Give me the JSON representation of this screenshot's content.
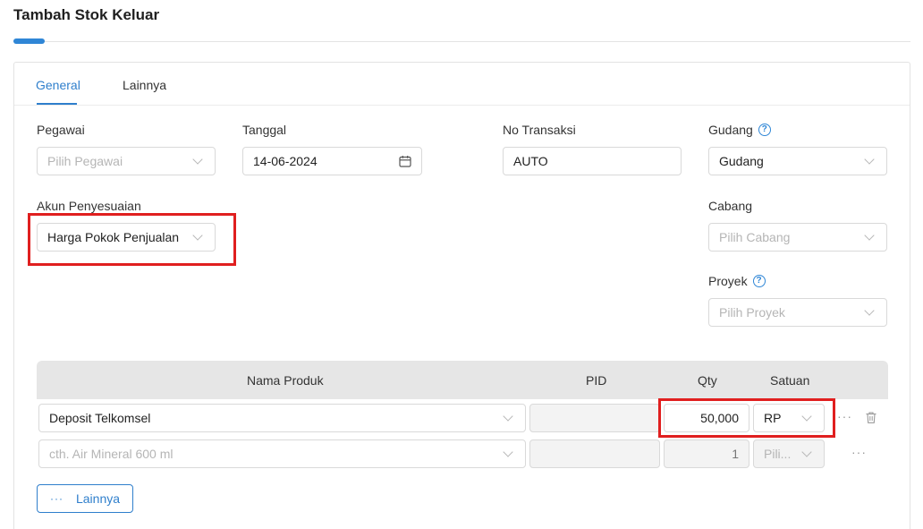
{
  "page": {
    "title": "Tambah Stok Keluar"
  },
  "tabs": [
    {
      "label": "General",
      "active": true
    },
    {
      "label": "Lainnya",
      "active": false
    }
  ],
  "form": {
    "pegawai": {
      "label": "Pegawai",
      "placeholder": "Pilih Pegawai"
    },
    "tanggal": {
      "label": "Tanggal",
      "value": "14-06-2024"
    },
    "no_transaksi": {
      "label": "No Transaksi",
      "value": "AUTO"
    },
    "gudang": {
      "label": "Gudang",
      "value": "Gudang"
    },
    "akun_penyesuaian": {
      "label": "Akun Penyesuaian",
      "value": "Harga Pokok Penjualan"
    },
    "cabang": {
      "label": "Cabang",
      "placeholder": "Pilih Cabang"
    },
    "proyek": {
      "label": "Proyek",
      "placeholder": "Pilih Proyek"
    }
  },
  "table": {
    "headers": {
      "nama_produk": "Nama Produk",
      "pid": "PID",
      "qty": "Qty",
      "satuan": "Satuan"
    },
    "rows": [
      {
        "nama_produk": "Deposit Telkomsel",
        "pid": "",
        "qty": "50,000",
        "satuan": "RP"
      },
      {
        "nama_produk_placeholder": "cth. Air Mineral 600 ml",
        "pid": "",
        "qty": "1",
        "satuan_placeholder": "Pili..."
      }
    ]
  },
  "actions": {
    "more_label": "Lainnya",
    "row_menu": "···"
  },
  "colors": {
    "accent": "#2f7fcc",
    "highlight": "#e01f1f",
    "header_bg": "#e6e6e6"
  },
  "icons": {
    "calendar": "calendar-icon",
    "help": "help-circle-icon",
    "trash": "trash-icon",
    "chevron": "chevron-down-icon"
  }
}
